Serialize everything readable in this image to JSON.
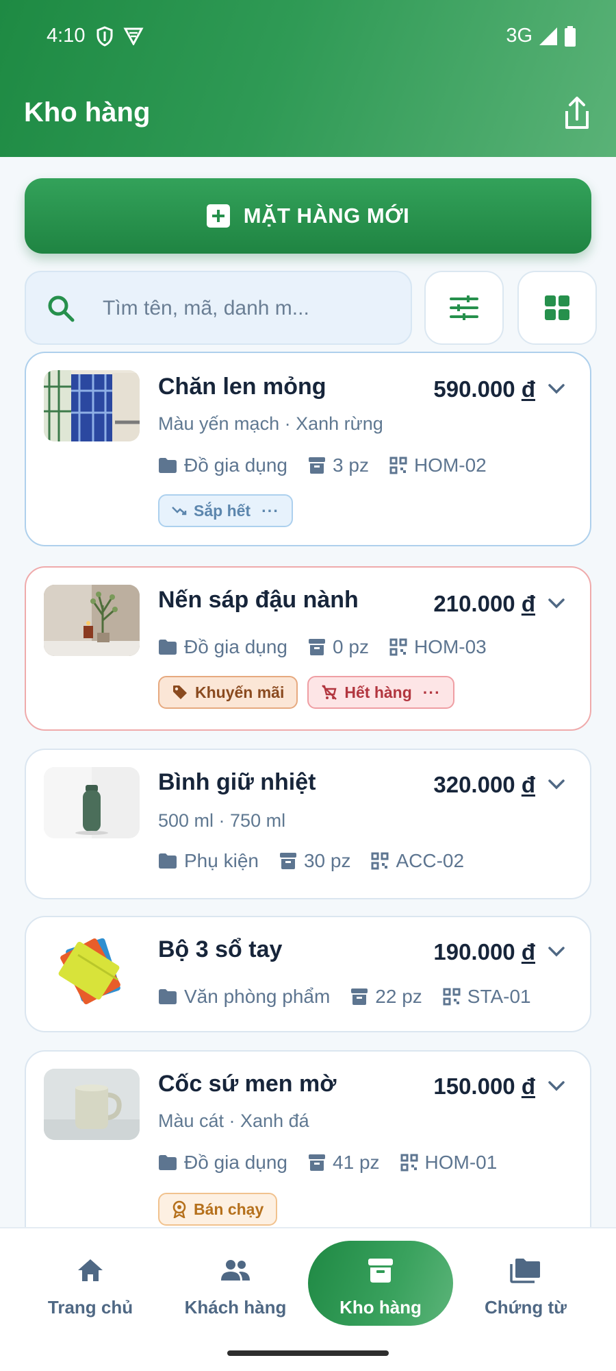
{
  "status_bar": {
    "time": "4:10",
    "network": "3G"
  },
  "app_bar": {
    "title": "Kho hàng"
  },
  "new_item_button": {
    "label": "MẶT HÀNG MỚI"
  },
  "search": {
    "placeholder": "Tìm tên, mã, danh m..."
  },
  "currency_symbol": "đ",
  "products": [
    {
      "name": "Chăn len mỏng",
      "price": "590.000",
      "variants": "Màu yến mạch · Xanh rừng",
      "category": "Đồ gia dụng",
      "stock": "3 pz",
      "sku": "HOM-02",
      "tags": [
        {
          "label": "Sắp hết",
          "kind": "low",
          "more": "···"
        }
      ]
    },
    {
      "name": "Nến sáp đậu nành",
      "price": "210.000",
      "variants": "",
      "category": "Đồ gia dụng",
      "stock": "0 pz",
      "sku": "HOM-03",
      "tags": [
        {
          "label": "Khuyến mãi",
          "kind": "promo"
        },
        {
          "label": "Hết hàng",
          "kind": "out",
          "more": "···"
        }
      ]
    },
    {
      "name": "Bình giữ nhiệt",
      "price": "320.000",
      "variants": "500 ml · 750 ml",
      "category": "Phụ kiện",
      "stock": "30 pz",
      "sku": "ACC-02",
      "tags": []
    },
    {
      "name": "Bộ 3 sổ tay",
      "price": "190.000",
      "variants": "",
      "category": "Văn phòng phẩm",
      "stock": "22 pz",
      "sku": "STA-01",
      "tags": []
    },
    {
      "name": "Cốc sứ men mờ",
      "price": "150.000",
      "variants": "Màu cát · Xanh đá",
      "category": "Đồ gia dụng",
      "stock": "41 pz",
      "sku": "HOM-01",
      "tags": [
        {
          "label": "Bán chạy",
          "kind": "best"
        }
      ]
    }
  ],
  "bottom_nav": [
    {
      "label": "Trang chủ",
      "icon": "home-icon"
    },
    {
      "label": "Khách hàng",
      "icon": "people-icon"
    },
    {
      "label": "Kho hàng",
      "icon": "archive-icon",
      "active": true
    },
    {
      "label": "Chứng từ",
      "icon": "folders-icon"
    }
  ],
  "colors": {
    "brand_green": "#26904c",
    "text_dark": "#17253a",
    "muted": "#5d7590"
  }
}
